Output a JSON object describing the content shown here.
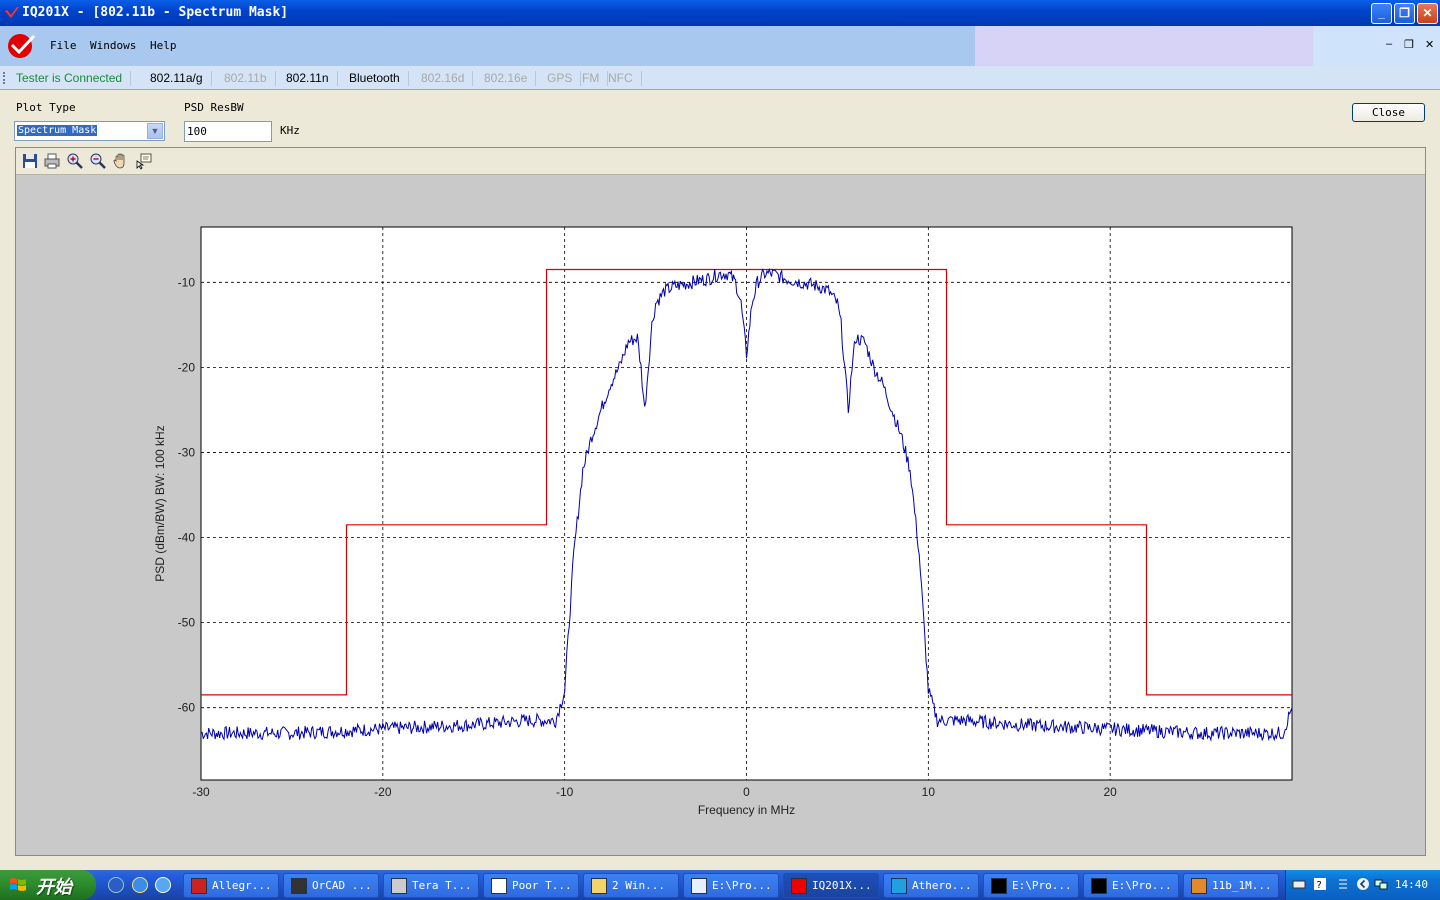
{
  "window": {
    "title": "IQ201X - [802.11b - Spectrum Mask]"
  },
  "menu": {
    "file": "File",
    "windows": "Windows",
    "help": "Help"
  },
  "tabs": [
    {
      "label": "Tester is Connected",
      "state": "status"
    },
    {
      "label": "802.11a/g",
      "state": "enabled"
    },
    {
      "label": "802.11b",
      "state": "disabled"
    },
    {
      "label": "802.11n",
      "state": "enabled"
    },
    {
      "label": "Bluetooth",
      "state": "enabled"
    },
    {
      "label": "802.16d",
      "state": "disabled"
    },
    {
      "label": "802.16e",
      "state": "disabled"
    },
    {
      "label": "GPS",
      "state": "disabled"
    },
    {
      "label": "FM",
      "state": "disabled"
    },
    {
      "label": "NFC",
      "state": "disabled"
    }
  ],
  "controls": {
    "plot_type_label": "Plot Type",
    "plot_type_value": "Spectrum Mask",
    "resbw_label": "PSD ResBW",
    "resbw_value": "100",
    "resbw_unit": "KHz",
    "close_label": "Close"
  },
  "toolbar_icons": [
    "save-icon",
    "print-icon",
    "zoom-in-icon",
    "zoom-out-icon",
    "pan-hand-icon",
    "data-cursor-icon"
  ],
  "chart_data": {
    "type": "line",
    "xlabel": "Frequency in MHz",
    "ylabel": "PSD (dBm/BW) BW: 100 kHz",
    "xlim": [
      -30,
      30
    ],
    "ylim": [
      -68.5,
      -3.5
    ],
    "xticks": [
      "-30",
      "-20",
      "-10",
      "0",
      "10",
      "20"
    ],
    "yticks": [
      "-10",
      "-20",
      "-30",
      "-40",
      "-50",
      "-60"
    ],
    "grid": true,
    "series": [
      {
        "role": "mask",
        "color": "#dd0000",
        "x": [
          -30,
          -22,
          -22,
          -11,
          -11,
          11,
          11,
          22,
          22,
          30
        ],
        "y": [
          -58.5,
          -58.5,
          -38.5,
          -38.5,
          -8.5,
          -8.5,
          -38.5,
          -38.5,
          -58.5,
          -58.5
        ]
      },
      {
        "role": "measured",
        "color": "#0000aa",
        "x": [
          -30,
          -25,
          -20,
          -15,
          -12,
          -10.5,
          -10,
          -9.5,
          -9,
          -8.5,
          -8,
          -7.5,
          -7,
          -6.5,
          -6,
          -5.8,
          -5.6,
          -5.4,
          -5.2,
          -5,
          -4.5,
          -4,
          -3,
          -2,
          -1.5,
          -1,
          -0.6,
          -0.3,
          0,
          0.3,
          0.6,
          1,
          1.5,
          2,
          3,
          4,
          4.5,
          5,
          5.2,
          5.4,
          5.6,
          5.8,
          6,
          6.5,
          7,
          7.5,
          8,
          8.5,
          9,
          9.5,
          10,
          10.5,
          12,
          15,
          20,
          25,
          29.5,
          30
        ],
        "y": [
          -63,
          -63,
          -62.5,
          -62,
          -61.5,
          -61.5,
          -58,
          -42,
          -32,
          -28,
          -25,
          -22,
          -20,
          -17,
          -16.5,
          -20,
          -25,
          -20,
          -15,
          -12.5,
          -11,
          -10.5,
          -10,
          -9.5,
          -9,
          -9,
          -10,
          -12.5,
          -18.5,
          -12.5,
          -10,
          -9,
          -9,
          -9.5,
          -10,
          -10.5,
          -11,
          -12.5,
          -15,
          -20,
          -25,
          -20,
          -16.5,
          -17,
          -20,
          -22,
          -25,
          -28,
          -32,
          -42,
          -58,
          -61.5,
          -61.5,
          -62,
          -62.5,
          -63,
          -63,
          -60
        ]
      }
    ]
  },
  "taskbar": {
    "start_label": "开始",
    "items": [
      {
        "label": "Allegr...",
        "icon": "allegro-icon"
      },
      {
        "label": "OrCAD ...",
        "icon": "orcad-icon"
      },
      {
        "label": "Tera T...",
        "icon": "teraterm-icon"
      },
      {
        "label": "Poor T...",
        "icon": "app-icon"
      },
      {
        "label": "2 Win...",
        "icon": "folder-icon"
      },
      {
        "label": "E:\\Pro...",
        "icon": "notepad-icon"
      },
      {
        "label": "IQ201X...",
        "icon": "iq-icon"
      },
      {
        "label": "Athero...",
        "icon": "atheros-icon"
      },
      {
        "label": "E:\\Pro...",
        "icon": "cmd-icon"
      },
      {
        "label": "E:\\Pro...",
        "icon": "cmd-icon"
      },
      {
        "label": "11b_1M...",
        "icon": "matlab-icon"
      }
    ],
    "clock": "14:40"
  }
}
